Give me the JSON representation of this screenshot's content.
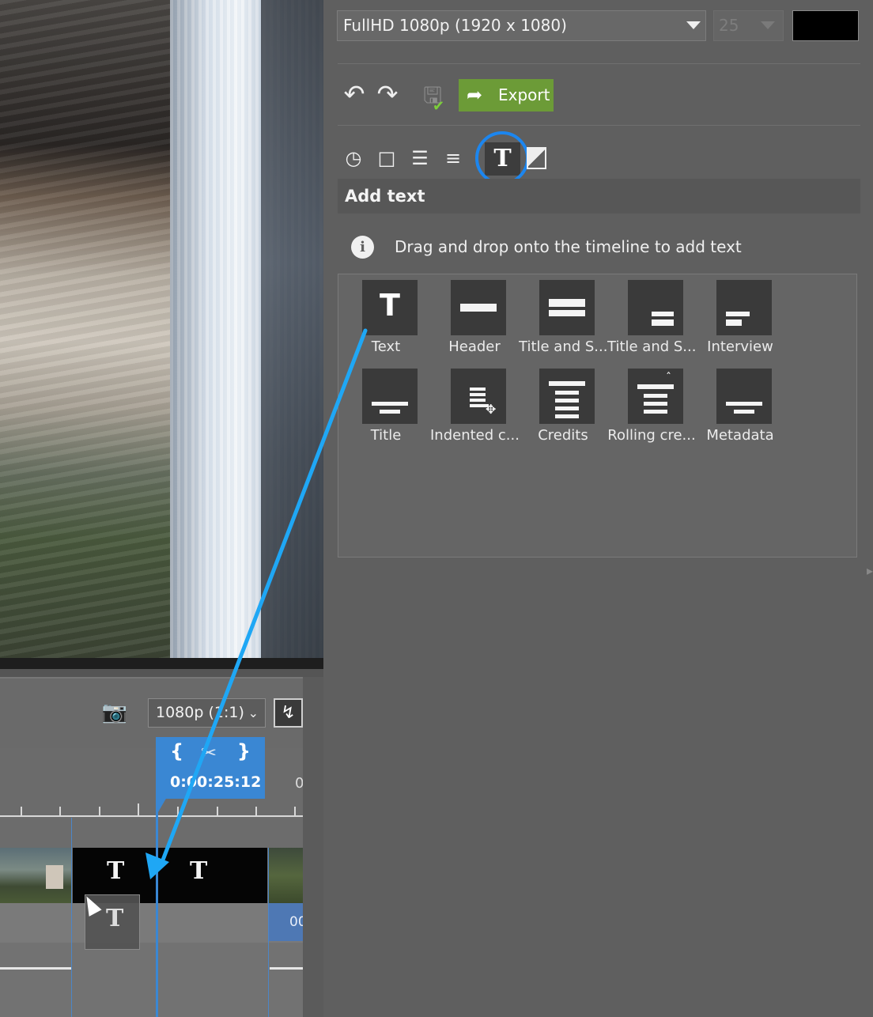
{
  "preview": {
    "image": "waterfall-cliff"
  },
  "preview_toolbar": {
    "camera_icon": "camera-icon",
    "resolution_label": "1080p (1:1)",
    "flash_icon": "lightning-icon"
  },
  "timeline": {
    "timecode": "0:00:25:12",
    "ruler_partial": "0",
    "clip_right_label": "00",
    "text_glyph": "T",
    "playhead_color": "#3a87d3"
  },
  "panel": {
    "format": "FullHD 1080p (1920 x 1080)",
    "fps": "25",
    "background_color": "#000000",
    "export_label": "Export",
    "export_color": "#6c9b37",
    "section_title": "Add text",
    "hint": "Drag and drop onto the timeline to add text",
    "templates": [
      {
        "label": "Text"
      },
      {
        "label": "Header"
      },
      {
        "label": "Title and S..."
      },
      {
        "label": "Title and S..."
      },
      {
        "label": "Interview"
      },
      {
        "label": "Title"
      },
      {
        "label": "Indented c..."
      },
      {
        "label": "Credits"
      },
      {
        "label": "Rolling cre..."
      },
      {
        "label": "Metadata"
      }
    ]
  },
  "annotation": {
    "highlight_color": "#1c86ef",
    "arrow_color": "#1fa7f5"
  }
}
